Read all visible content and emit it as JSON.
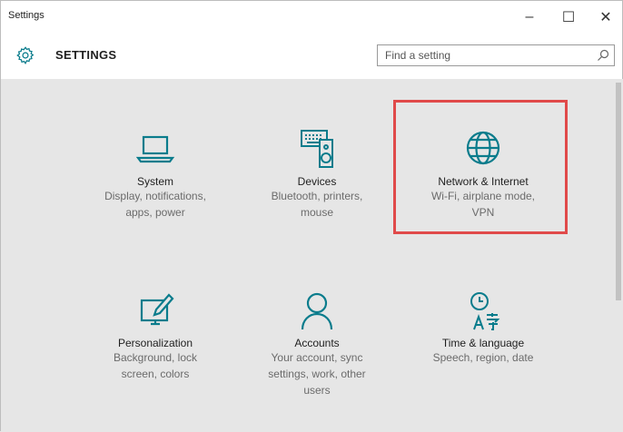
{
  "window": {
    "title": "Settings",
    "minimize_glyph": "–",
    "maximize_glyph": "☐",
    "close_glyph": "✕"
  },
  "header": {
    "title": "SETTINGS",
    "icon": "gear-icon"
  },
  "search": {
    "placeholder": "Find a setting",
    "value": "",
    "icon": "search-icon"
  },
  "tiles": [
    {
      "id": "system",
      "name": "System",
      "description": "Display, notifications, apps, power",
      "icon": "laptop-icon"
    },
    {
      "id": "devices",
      "name": "Devices",
      "description": "Bluetooth, printers, mouse",
      "icon": "keyboard-speaker-icon"
    },
    {
      "id": "network",
      "name": "Network & Internet",
      "description": "Wi-Fi, airplane mode, VPN",
      "icon": "globe-icon",
      "highlighted": true
    },
    {
      "id": "personalization",
      "name": "Personalization",
      "description": "Background, lock screen, colors",
      "icon": "paint-screen-icon"
    },
    {
      "id": "accounts",
      "name": "Accounts",
      "description": "Your account, sync settings, work, other users",
      "icon": "person-icon"
    },
    {
      "id": "time",
      "name": "Time & language",
      "description": "Speech, region, date",
      "icon": "clock-language-icon"
    }
  ],
  "colors": {
    "accent": "#0a7c8c",
    "highlight_border": "#e04a4a",
    "background": "#e6e6e6"
  }
}
